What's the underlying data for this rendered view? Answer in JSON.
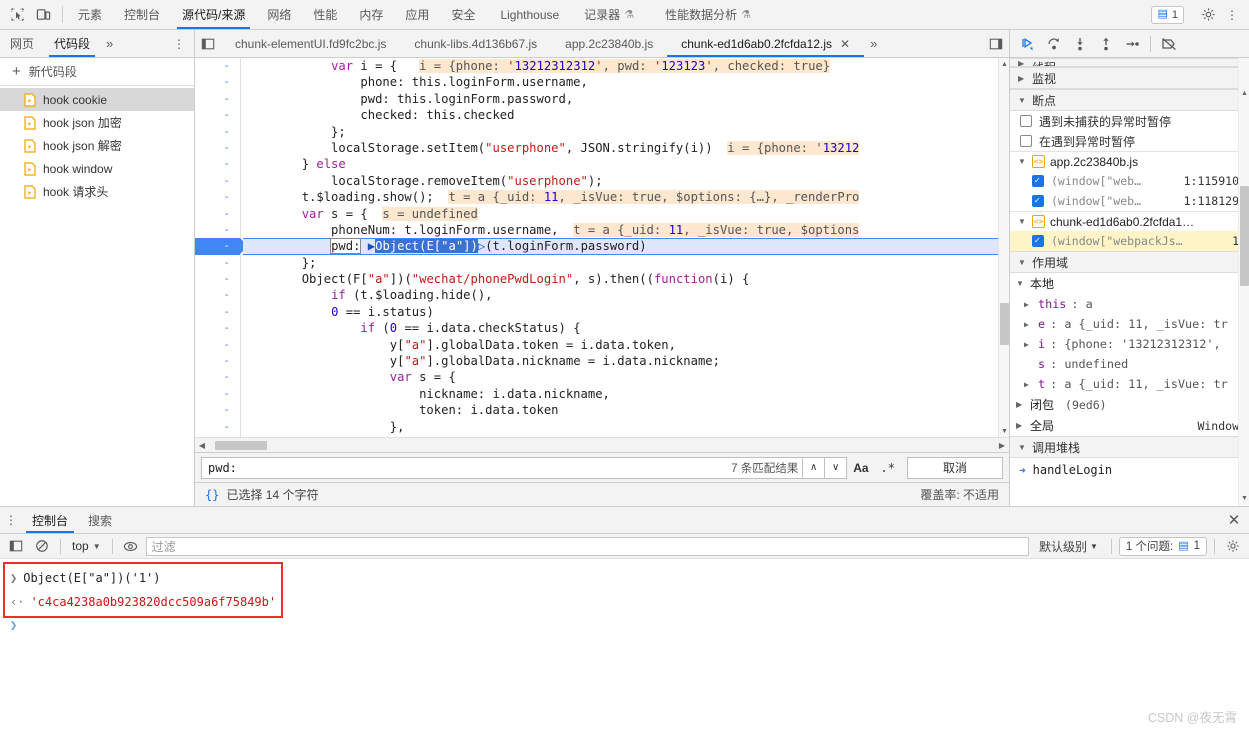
{
  "window": {
    "main_tabs": [
      {
        "label": "元素",
        "active": false,
        "flask": false
      },
      {
        "label": "控制台",
        "active": false,
        "flask": false
      },
      {
        "label": "源代码/来源",
        "active": true,
        "flask": false
      },
      {
        "label": "网络",
        "active": false,
        "flask": false
      },
      {
        "label": "性能",
        "active": false,
        "flask": false
      },
      {
        "label": "内存",
        "active": false,
        "flask": false
      },
      {
        "label": "应用",
        "active": false,
        "flask": false
      },
      {
        "label": "安全",
        "active": false,
        "flask": false
      },
      {
        "label": "Lighthouse",
        "active": false,
        "flask": false
      },
      {
        "label": "记录器",
        "active": false,
        "flask": true
      },
      {
        "label": "性能数据分析",
        "active": false,
        "flask": true
      }
    ],
    "inspect_icon": "inspect-element-icon",
    "device_icon": "device-toolbar-icon",
    "issue_count": "1",
    "settings_icon": "gear-icon",
    "more_icon": "more-vertical-icon"
  },
  "navigator": {
    "tabs": [
      {
        "label": "网页",
        "active": false
      },
      {
        "label": "代码段",
        "active": true
      }
    ],
    "more_label": "»",
    "dots_icon": "more-vertical-icon",
    "new_snippet": "新代码段",
    "snippets": [
      {
        "label": "hook cookie",
        "selected": true
      },
      {
        "label": "hook json 加密",
        "selected": false
      },
      {
        "label": "hook json 解密",
        "selected": false
      },
      {
        "label": "hook window",
        "selected": false
      },
      {
        "label": "hook 请求头",
        "selected": false
      }
    ]
  },
  "editor": {
    "file_tabs": [
      {
        "label": "chunk-elementUI.fd9fc2bc.js",
        "active": false,
        "closable": false
      },
      {
        "label": "chunk-libs.4d136b67.js",
        "active": false,
        "closable": false
      },
      {
        "label": "app.2c23840b.js",
        "active": false,
        "closable": false
      },
      {
        "label": "chunk-ed1d6ab0.2fcfda12.js",
        "active": true,
        "closable": true
      }
    ],
    "tab_more": "»",
    "panel_left_icon": "show-navigator-icon",
    "panel_right_icon": "show-debugger-icon",
    "gutter_marker": "-",
    "code_lines": [
      "            var i = {   i = {phone: '13212312312', pwd: '123123', checked: true}",
      "                phone: this.loginForm.username,",
      "                pwd: this.loginForm.password,",
      "                checked: this.checked",
      "            };",
      "            localStorage.setItem(\"userphone\", JSON.stringify(i))  i = {phone: '13212",
      "        } else",
      "            localStorage.removeItem(\"userphone\");",
      "        t.$loading.show();  t = a {_uid: 11, _isVue: true, $options: {…}, _renderPro",
      "        var s = {  s = undefined",
      "            phoneNum: t.loginForm.username,  t = a {_uid: 11, _isVue: true, $options",
      "            pwd: Object(E[\"a\"])(t.loginForm.password)",
      "        };",
      "        Object(F[\"a\"])(\"wechat/phonePwdLogin\", s).then((function(i) {",
      "            if (t.$loading.hide(),",
      "            0 == i.status)",
      "                if (0 == i.data.checkStatus) {",
      "                    y[\"a\"].globalData.token = i.data.token,",
      "                    y[\"a\"].globalData.nickname = i.data.nickname;",
      "                    var s = {",
      "                        nickname: i.data.nickname,",
      "                        token: i.data.token",
      "                    },"
    ],
    "execution_line_index": 11,
    "selected_text": "Object(E[\"a\"])"
  },
  "search": {
    "value": "pwd:",
    "placeholder": "",
    "match_count": "7 条匹配结果",
    "prev_icon": "chevron-up-icon",
    "next_icon": "chevron-down-icon",
    "match_case_label": "Aa",
    "regex_label": ".*",
    "cancel_label": "取消"
  },
  "statusbar": {
    "pretty_print_icon": "{}",
    "selection_text": "已选择 14 个字符",
    "coverage_text": "覆盖率: 不适用"
  },
  "debugger": {
    "toolbar": [
      {
        "name": "resume-button",
        "glyph": "resume"
      },
      {
        "name": "step-over-button",
        "glyph": "step-over"
      },
      {
        "name": "step-into-button",
        "glyph": "step-into"
      },
      {
        "name": "step-out-button",
        "glyph": "step-out"
      },
      {
        "name": "step-button",
        "glyph": "step"
      },
      {
        "name": "deactivate-breakpoints-button",
        "glyph": "deactivate"
      }
    ],
    "threads_label": "线程",
    "watch_label": "监视",
    "breakpoints_label": "断点",
    "pause_uncaught_label": "遇到未捕获的异常时暂停",
    "pause_uncaught_checked": false,
    "pause_exceptions_label": "在遇到异常时暂停",
    "pause_exceptions_checked": false,
    "breakpoint_groups": [
      {
        "file": "app.2c23840b.js",
        "items": [
          {
            "text": "(window[\"web…",
            "loc": "1:115910",
            "checked": true,
            "highlight": false
          },
          {
            "text": "(window[\"web…",
            "loc": "1:118129",
            "checked": true,
            "highlight": false
          }
        ]
      },
      {
        "file": "chunk-ed1d6ab0.2fcfda1…",
        "items": [
          {
            "text": "(window[\"webpackJs…",
            "loc": "1",
            "checked": true,
            "highlight": true
          }
        ]
      }
    ],
    "scope_label": "作用域",
    "local_label": "本地",
    "local_vars": [
      {
        "name": "this",
        "value": ": a",
        "expandable": true
      },
      {
        "name": "e",
        "value": ": a {_uid: 11, _isVue: tr",
        "expandable": true
      },
      {
        "name": "i",
        "value": ": {phone: '13212312312', ",
        "expandable": true
      },
      {
        "name": "s",
        "value": ": undefined",
        "expandable": false
      },
      {
        "name": "t",
        "value": ": a {_uid: 11, _isVue: tr",
        "expandable": true
      }
    ],
    "closure_label": "闭包",
    "closure_value": "(9ed6)",
    "global_label": "全局",
    "global_value": "Window",
    "callstack_label": "调用堆栈",
    "callstack_items": [
      {
        "label": "handleLogin"
      }
    ]
  },
  "drawer": {
    "dots_icon": "more-vertical-icon",
    "tabs": [
      {
        "label": "控制台",
        "active": true
      },
      {
        "label": "搜索",
        "active": false
      }
    ],
    "close_icon": "close-icon",
    "toolbar": {
      "sidebar_icon": "console-sidebar-icon",
      "clear_icon": "clear-console-icon",
      "context_value": "top",
      "eye_icon": "live-expression-icon",
      "filter_placeholder": "过滤",
      "level_value": "默认级别",
      "issues_label": "1 个问题:",
      "issues_count": "1",
      "settings_icon": "gear-icon"
    },
    "messages": [
      {
        "type": "input",
        "marker": "❯",
        "text": "Object(E[\"a\"])('1')"
      },
      {
        "type": "output",
        "marker": "‹·",
        "text": "'c4ca4238a0b923820dcc509a6f75849b'"
      }
    ],
    "prompt_marker": "❯",
    "watermark": "CSDN @夜无霄"
  },
  "colors": {
    "accent": "#1a73e8",
    "exec_line": "#dde6fb",
    "hint": "#fde7cf",
    "redbox": "#e8312a",
    "string": "#c41a16",
    "keyword": "#a020a0",
    "number": "#1c00cf"
  }
}
